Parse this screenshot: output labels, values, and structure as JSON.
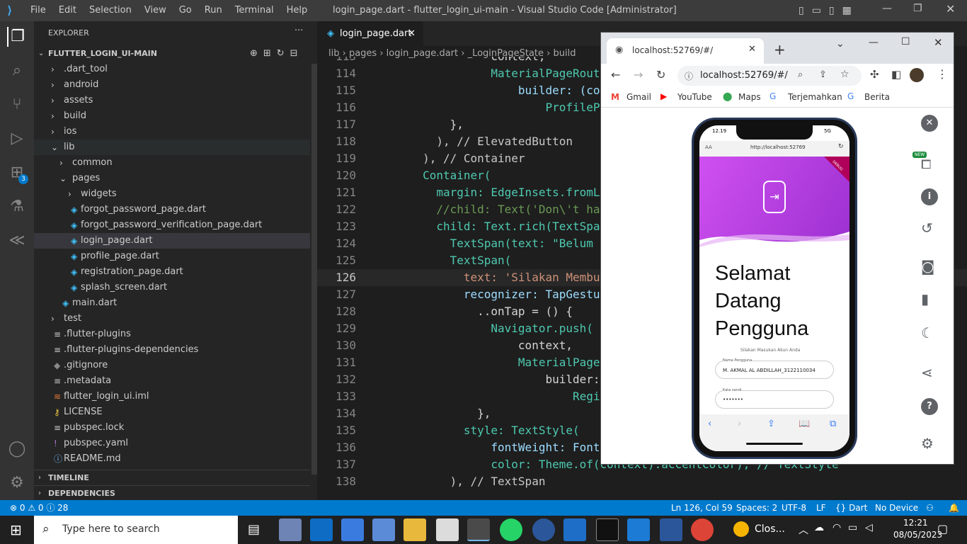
{
  "titlebar": {
    "menus": [
      "File",
      "Edit",
      "Selection",
      "View",
      "Go",
      "Run",
      "Terminal",
      "Help"
    ],
    "title": "login_page.dart - flutter_login_ui-main - Visual Studio Code [Administrator]"
  },
  "explorer": {
    "header": "EXPLORER",
    "more": "···",
    "root": "FLUTTER_LOGIN_UI-MAIN",
    "items": [
      {
        "label": ".dart_tool"
      },
      {
        "label": "android"
      },
      {
        "label": "assets"
      },
      {
        "label": "build"
      },
      {
        "label": "ios"
      },
      {
        "label": "lib"
      },
      {
        "label": "common"
      },
      {
        "label": "pages"
      },
      {
        "label": "widgets"
      },
      {
        "label": "forgot_password_page.dart"
      },
      {
        "label": "forgot_password_verification_page.dart"
      },
      {
        "label": "login_page.dart"
      },
      {
        "label": "profile_page.dart"
      },
      {
        "label": "registration_page.dart"
      },
      {
        "label": "splash_screen.dart"
      },
      {
        "label": "main.dart"
      },
      {
        "label": "test"
      },
      {
        "label": ".flutter-plugins"
      },
      {
        "label": ".flutter-plugins-dependencies"
      },
      {
        "label": ".gitignore"
      },
      {
        "label": ".metadata"
      },
      {
        "label": "flutter_login_ui.iml"
      },
      {
        "label": "LICENSE"
      },
      {
        "label": "pubspec.lock"
      },
      {
        "label": "pubspec.yaml"
      },
      {
        "label": "README.md"
      }
    ],
    "timeline": "TIMELINE",
    "dependencies": "DEPENDENCIES"
  },
  "editor": {
    "tab_label": "login_page.dart",
    "close": "✕",
    "breadcrumb": [
      "lib",
      "pages",
      "login_page.dart",
      "_LoginPageState",
      "build"
    ],
    "lines": [
      {
        "n": "113",
        "t": "                  context,"
      },
      {
        "n": "114",
        "t": "                  MaterialPageRoute("
      },
      {
        "n": "115",
        "t": "                      builder: (co"
      },
      {
        "n": "116",
        "t": "                          ProfileP"
      },
      {
        "n": "117",
        "t": "            },"
      },
      {
        "n": "118",
        "t": "          ), // ElevatedButton"
      },
      {
        "n": "119",
        "t": "        ), // Container"
      },
      {
        "n": "120",
        "t": "        Container("
      },
      {
        "n": "121",
        "t": "          margin: EdgeInsets.fromL"
      },
      {
        "n": "122",
        "t": "          //child: Text('Don\\'t ha"
      },
      {
        "n": "123",
        "t": "          child: Text.rich(TextSpa"
      },
      {
        "n": "124",
        "t": "            TextSpan(text: \"Belum "
      },
      {
        "n": "125",
        "t": "            TextSpan("
      },
      {
        "n": "126",
        "t": "              text: 'Silakan Membu"
      },
      {
        "n": "127",
        "t": "              recognizer: TapGestu"
      },
      {
        "n": "128",
        "t": "                ..onTap = () {"
      },
      {
        "n": "129",
        "t": "                  Navigator.push("
      },
      {
        "n": "130",
        "t": "                      context,"
      },
      {
        "n": "131",
        "t": "                      MaterialPage"
      },
      {
        "n": "132",
        "t": "                          builder:"
      },
      {
        "n": "133",
        "t": "                              Regi"
      },
      {
        "n": "134",
        "t": "                },"
      },
      {
        "n": "135",
        "t": "              style: TextStyle("
      },
      {
        "n": "136",
        "t": "                  fontWeight: Font"
      },
      {
        "n": "137",
        "t": "                  color: Theme.of(context).accentColor), // TextStyle"
      },
      {
        "n": "138",
        "t": "            ), // TextSpan"
      }
    ]
  },
  "statusbar": {
    "problems": "⊗ 0 ⚠ 0 ⓘ 28",
    "position": "Ln 126, Col 59",
    "spaces": "Spaces: 2",
    "encoding": "UTF-8",
    "eol": "LF",
    "language": "{} Dart",
    "device": "No Device"
  },
  "browser": {
    "tab_title": "localhost:52769/#/",
    "url": "localhost:52769/#/",
    "bookmarks": [
      "Gmail",
      "YouTube",
      "Maps",
      "Terjemahkan",
      "Berita"
    ],
    "phone": {
      "time": "12.19",
      "network": "5G",
      "aa": "AA",
      "url": "http://localhost:52769",
      "banner": "DEBUG",
      "heading": "Selamat Datang Pengguna",
      "subtitle": "Silakan Masukan Akun Anda",
      "username_label": "Nama Pengguna",
      "username_value": "M. AKMAL AL ABDILLAH_3122110034",
      "password_label": "Kata sandi",
      "password_value": "•••••••"
    },
    "new_badge": "NEW"
  },
  "taskbar": {
    "search_placeholder": "Type here to search",
    "time": "12:21",
    "date": "08/05/2023",
    "app_label": "Clos..."
  },
  "colors": {
    "accent": "#007acc",
    "purple_start": "#d050f0",
    "purple_end": "#9b2fd0"
  }
}
